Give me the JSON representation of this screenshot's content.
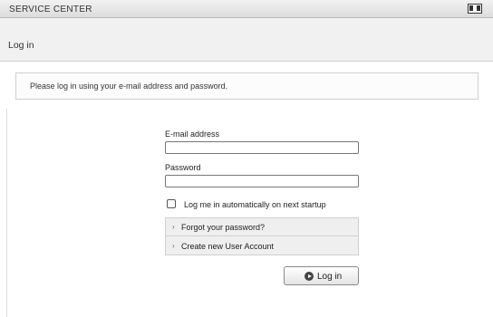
{
  "titlebar": {
    "title": "SERVICE CENTER",
    "icon": "window-layout-icon"
  },
  "header": {
    "title": "Log in"
  },
  "info": {
    "message": "Please log in using your e-mail address and password."
  },
  "form": {
    "email_label": "E-mail address",
    "email_value": "",
    "password_label": "Password",
    "password_value": "",
    "auto_login_label": "Log me in automatically on next startup",
    "auto_login_checked": false
  },
  "links": {
    "forgot_password": "Forgot your password?",
    "create_account": "Create new User Account",
    "chevron": "›"
  },
  "login_button": {
    "label": "Log in",
    "icon": "play-circle-icon"
  }
}
